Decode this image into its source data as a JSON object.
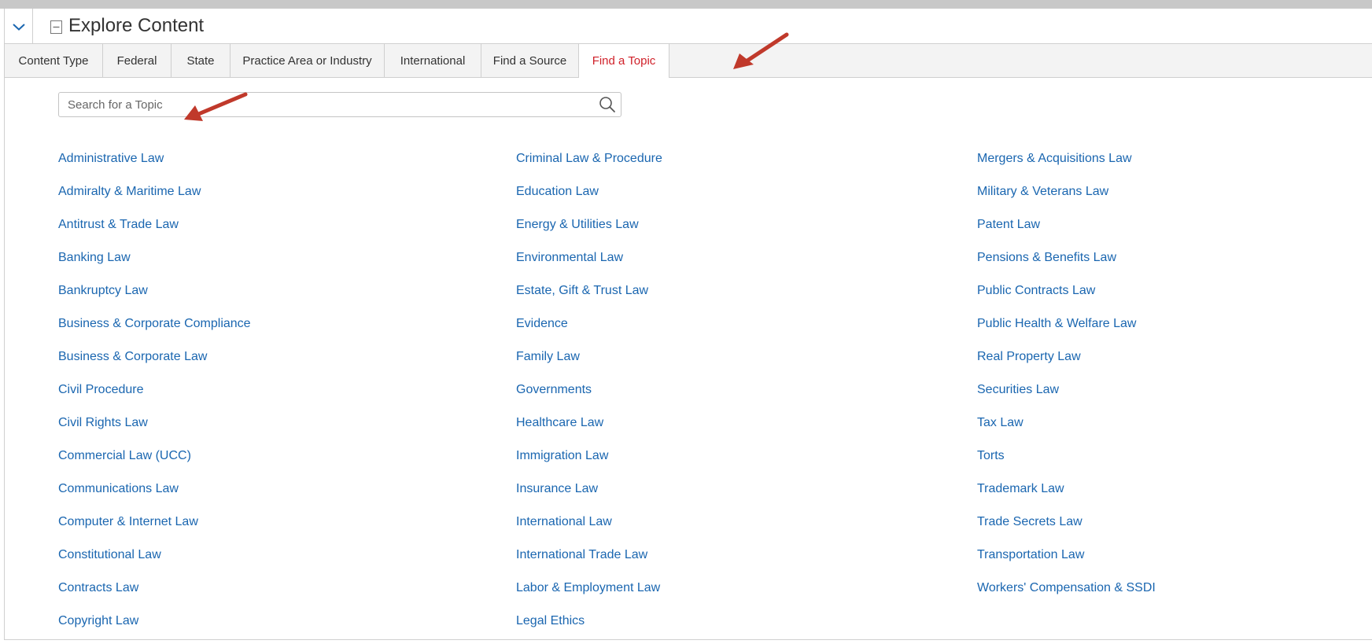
{
  "header": {
    "title": "Explore Content"
  },
  "tabs": [
    {
      "label": "Content Type"
    },
    {
      "label": "Federal"
    },
    {
      "label": "State"
    },
    {
      "label": "Practice Area or Industry"
    },
    {
      "label": "International"
    },
    {
      "label": "Find a Source"
    },
    {
      "label": "Find a Topic",
      "active": true
    }
  ],
  "search": {
    "placeholder": "Search for a Topic",
    "value": ""
  },
  "topics": {
    "column1": [
      "Administrative Law",
      "Admiralty & Maritime Law",
      "Antitrust & Trade Law",
      "Banking Law",
      "Bankruptcy Law",
      "Business & Corporate Compliance",
      "Business & Corporate Law",
      "Civil Procedure",
      "Civil Rights Law",
      "Commercial Law (UCC)",
      "Communications Law",
      "Computer & Internet Law",
      "Constitutional Law",
      "Contracts Law",
      "Copyright Law"
    ],
    "column2": [
      "Criminal Law & Procedure",
      "Education Law",
      "Energy & Utilities Law",
      "Environmental Law",
      "Estate, Gift & Trust Law",
      "Evidence",
      "Family Law",
      "Governments",
      "Healthcare Law",
      "Immigration Law",
      "Insurance Law",
      "International Law",
      "International Trade Law",
      "Labor & Employment Law",
      "Legal Ethics"
    ],
    "column3": [
      "Mergers & Acquisitions Law",
      "Military & Veterans Law",
      "Patent Law",
      "Pensions & Benefits Law",
      "Public Contracts Law",
      "Public Health & Welfare Law",
      "Real Property Law",
      "Securities Law",
      "Tax Law",
      "Torts",
      "Trademark Law",
      "Trade Secrets Law",
      "Transportation Law",
      "Workers' Compensation & SSDI"
    ]
  },
  "colors": {
    "link": "#1a66b0",
    "active_tab": "#d0212a",
    "annotation_arrow": "#c0392b",
    "tab_bg": "#f3f3f3",
    "border": "#cfcfcf"
  },
  "icons": {
    "collapse": "chevron-down-icon",
    "section": "collapse-square-icon",
    "search": "search-icon",
    "annotation": "arrow-annotation-icon"
  }
}
